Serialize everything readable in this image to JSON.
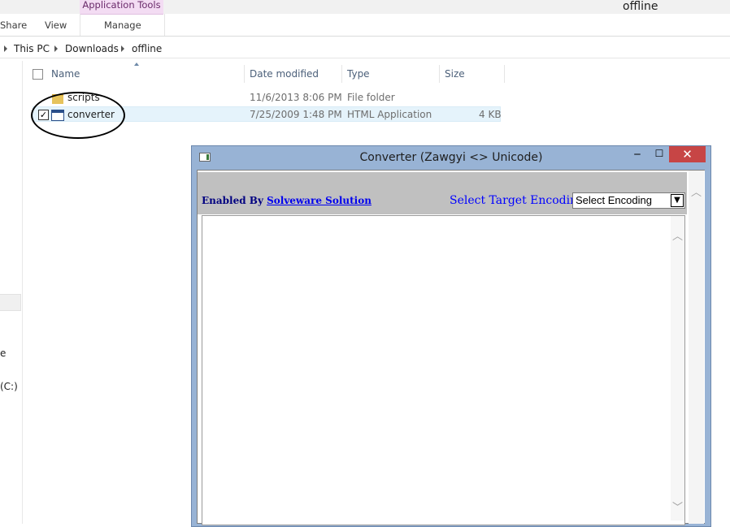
{
  "explorer": {
    "context_tab": "Application Tools",
    "ribbon_tabs": [
      "Share",
      "View",
      "Manage"
    ],
    "window_title": "offline",
    "breadcrumb": [
      "This PC",
      "Downloads",
      "offline"
    ],
    "nav_items": [
      "e",
      "(C:)"
    ],
    "columns": {
      "name": "Name",
      "date": "Date modified",
      "type": "Type",
      "size": "Size"
    },
    "rows": [
      {
        "name": "scripts",
        "date": "11/6/2013 8:06 PM",
        "type": "File folder",
        "size": ""
      },
      {
        "name": "converter",
        "date": "7/25/2009 1:48 PM",
        "type": "HTML Application",
        "size": "4 KB",
        "checked": true
      }
    ]
  },
  "converter": {
    "title": "Converter (Zawgyi <> Unicode)",
    "enabled_by": "Enabled By ",
    "link_text": "Solveware Solution",
    "target_label": "Select Target Encoding :",
    "select_value": "Select Encoding",
    "textarea_value": ""
  },
  "colors": {
    "close_button": "#c74545",
    "window_frame": "#98b3d5",
    "context_tab": "#f3dcf3",
    "selection": "#e5f3fb"
  }
}
